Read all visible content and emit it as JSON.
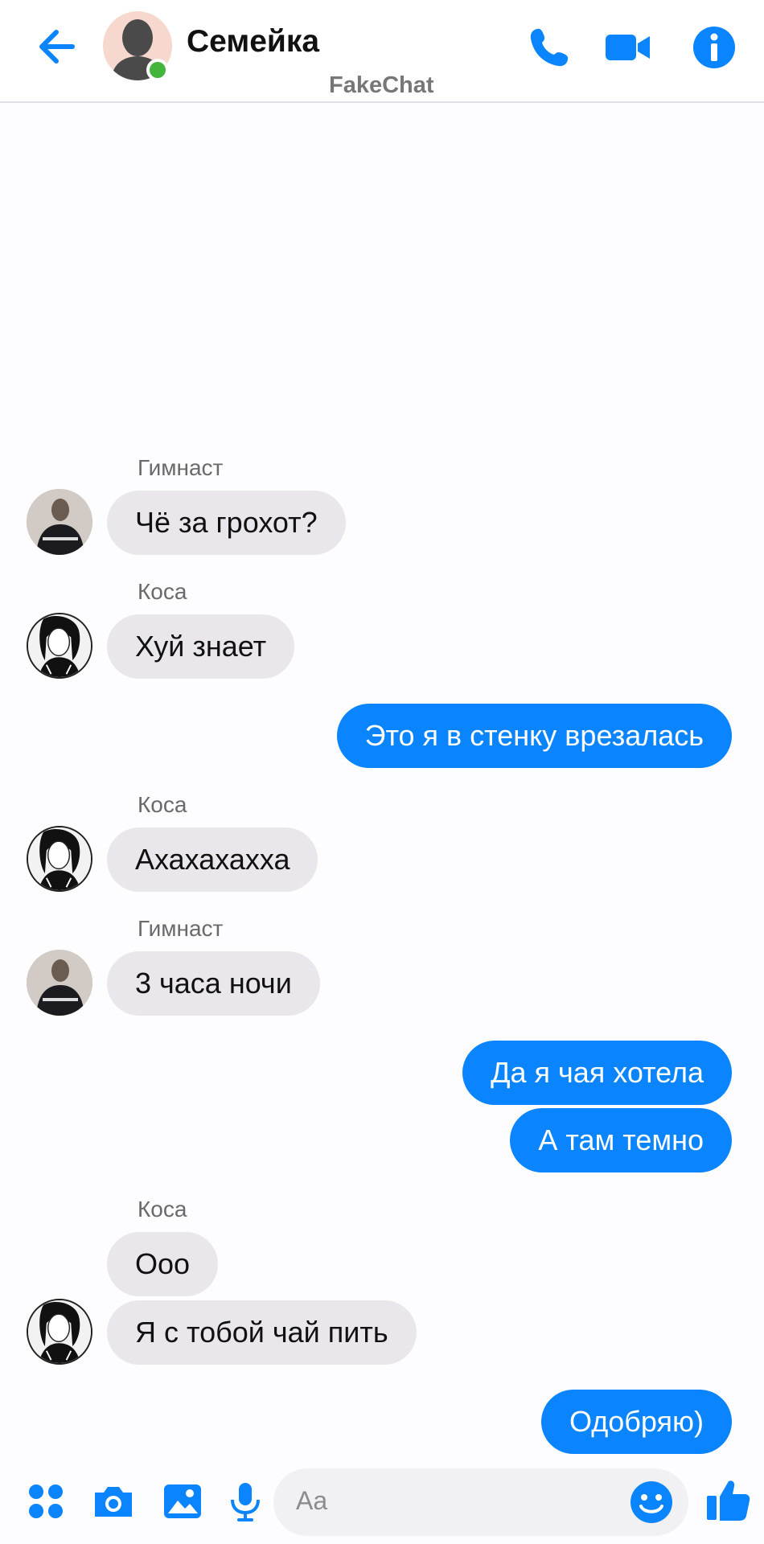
{
  "header": {
    "title": "Семейка",
    "watermark": "FakeChat"
  },
  "icons": {
    "back": "back-arrow-icon",
    "call": "phone-icon",
    "video": "video-camera-icon",
    "info": "info-icon"
  },
  "messages": [
    {
      "type": "in",
      "sender": "Гимнаст",
      "text": "Чё за грохот?"
    },
    {
      "type": "in",
      "sender": "Коса",
      "text": "Хуй знает"
    },
    {
      "type": "out",
      "text": "Это я в стенку врезалась"
    },
    {
      "type": "in",
      "sender": "Коса",
      "text": "Ахахахахха"
    },
    {
      "type": "in",
      "sender": "Гимнаст",
      "text": "3 часа ночи"
    },
    {
      "type": "out",
      "text": "Да я чая хотела"
    },
    {
      "type": "out",
      "text": "А там темно"
    },
    {
      "type": "in",
      "sender": "Коса",
      "text": "Ооо"
    },
    {
      "type": "in",
      "text": "Я с тобой чай пить"
    },
    {
      "type": "out",
      "text": "Одобряю)"
    }
  ],
  "composer": {
    "placeholder": "Aa"
  },
  "colors": {
    "accent": "#0a84ff",
    "incoming_bubble": "#e9e7eb",
    "online": "#44b53c"
  }
}
